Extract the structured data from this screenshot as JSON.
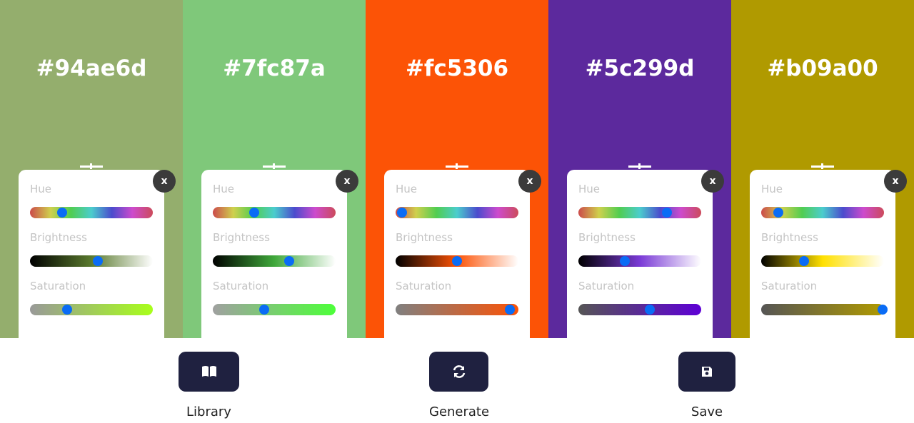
{
  "palette": [
    {
      "hex": "#94ae6d",
      "color": "#94ae6d",
      "close_label": "x",
      "hue_label": "Hue",
      "brightness_label": "Brightness",
      "saturation_label": "Saturation",
      "hue": 0.26,
      "brightness": 0.55,
      "saturation": 0.3,
      "brightness_gradient": [
        "#000000",
        "#5a7a2e",
        "#ffffff"
      ],
      "saturation_gradient": [
        "#999999",
        "#a8ff1a"
      ]
    },
    {
      "hex": "#7fc87a",
      "color": "#7fc87a",
      "close_label": "x",
      "hue_label": "Hue",
      "brightness_label": "Brightness",
      "saturation_label": "Saturation",
      "hue": 0.34,
      "brightness": 0.62,
      "saturation": 0.42,
      "brightness_gradient": [
        "#000000",
        "#3fa83a",
        "#ffffff"
      ],
      "saturation_gradient": [
        "#a0a0a0",
        "#4dff3a"
      ]
    },
    {
      "hex": "#fc5306",
      "color": "#fc5306",
      "close_label": "x",
      "hue_label": "Hue",
      "brightness_label": "Brightness",
      "saturation_label": "Saturation",
      "hue": 0.05,
      "brightness": 0.5,
      "saturation": 0.93,
      "brightness_gradient": [
        "#000000",
        "#fc5306",
        "#ffffff"
      ],
      "saturation_gradient": [
        "#808080",
        "#fc5306"
      ]
    },
    {
      "hex": "#5c299d",
      "color": "#5c299d",
      "close_label": "x",
      "hue_label": "Hue",
      "brightness_label": "Brightness",
      "saturation_label": "Saturation",
      "hue": 0.72,
      "brightness": 0.38,
      "saturation": 0.58,
      "brightness_gradient": [
        "#000000",
        "#7a3ad6",
        "#ffffff"
      ],
      "saturation_gradient": [
        "#555555",
        "#5e00d6"
      ]
    },
    {
      "hex": "#b09a00",
      "color": "#b09a00",
      "close_label": "x",
      "hue_label": "Hue",
      "brightness_label": "Brightness",
      "saturation_label": "Saturation",
      "hue": 0.14,
      "brightness": 0.35,
      "saturation": 0.99,
      "brightness_gradient": [
        "#000000",
        "#ffe000",
        "#ffffff"
      ],
      "saturation_gradient": [
        "#555555",
        "#b09a00"
      ]
    }
  ],
  "actions": {
    "library": {
      "label": "Library",
      "icon": "book-icon"
    },
    "generate": {
      "label": "Generate",
      "icon": "refresh-icon"
    },
    "save": {
      "label": "Save",
      "icon": "floppy-disk-icon"
    }
  },
  "colors": {
    "button": "#1f2140",
    "slider_thumb": "#0a6cf5"
  }
}
